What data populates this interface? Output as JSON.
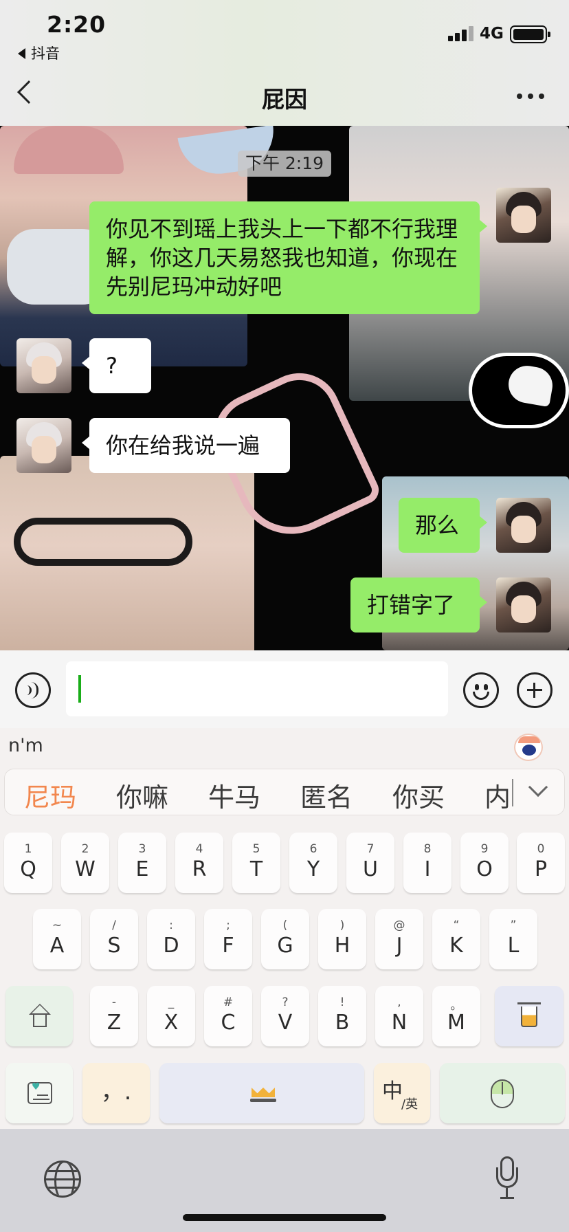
{
  "status_bar": {
    "time": "2:20",
    "back_app": "抖音",
    "network": "4G"
  },
  "header": {
    "title": "屁因"
  },
  "chat": {
    "timestamp": "下午 2:19",
    "messages": [
      {
        "sender": "me",
        "text": "你见不到瑶上我头上一下都不行我理解，你这几天易怒我也知道，你现在先别尼玛冲动好吧"
      },
      {
        "sender": "other",
        "text": "?"
      },
      {
        "sender": "other",
        "text": "你在给我说一遍"
      },
      {
        "sender": "me",
        "text": "那么"
      },
      {
        "sender": "me",
        "text": "打错字了"
      }
    ]
  },
  "input": {
    "value": ""
  },
  "keyboard": {
    "composition": "n'm",
    "candidates": [
      "尼玛",
      "你嘛",
      "牛马",
      "匿名",
      "你买",
      "内"
    ],
    "row1": [
      {
        "num": "1",
        "letter": "Q"
      },
      {
        "num": "2",
        "letter": "W"
      },
      {
        "num": "3",
        "letter": "E"
      },
      {
        "num": "4",
        "letter": "R"
      },
      {
        "num": "5",
        "letter": "T"
      },
      {
        "num": "6",
        "letter": "Y"
      },
      {
        "num": "7",
        "letter": "U"
      },
      {
        "num": "8",
        "letter": "I"
      },
      {
        "num": "9",
        "letter": "O"
      },
      {
        "num": "0",
        "letter": "P"
      }
    ],
    "row2": [
      {
        "num": "~",
        "letter": "A"
      },
      {
        "num": "/",
        "letter": "S"
      },
      {
        "num": ":",
        "letter": "D"
      },
      {
        "num": ";",
        "letter": "F"
      },
      {
        "num": "(",
        "letter": "G"
      },
      {
        "num": ")",
        "letter": "H"
      },
      {
        "num": "@",
        "letter": "J"
      },
      {
        "num": "“",
        "letter": "K"
      },
      {
        "num": "”",
        "letter": "L"
      }
    ],
    "row3": [
      {
        "num": "-",
        "letter": "Z"
      },
      {
        "num": "_",
        "letter": "X"
      },
      {
        "num": "#",
        "letter": "C"
      },
      {
        "num": "?",
        "letter": "V"
      },
      {
        "num": "!",
        "letter": "B"
      },
      {
        "num": ",",
        "letter": "N"
      },
      {
        "num": "。",
        "letter": "M"
      }
    ],
    "punct_key": "，.",
    "lang_key_main": "中",
    "lang_key_sub": "/英"
  }
}
